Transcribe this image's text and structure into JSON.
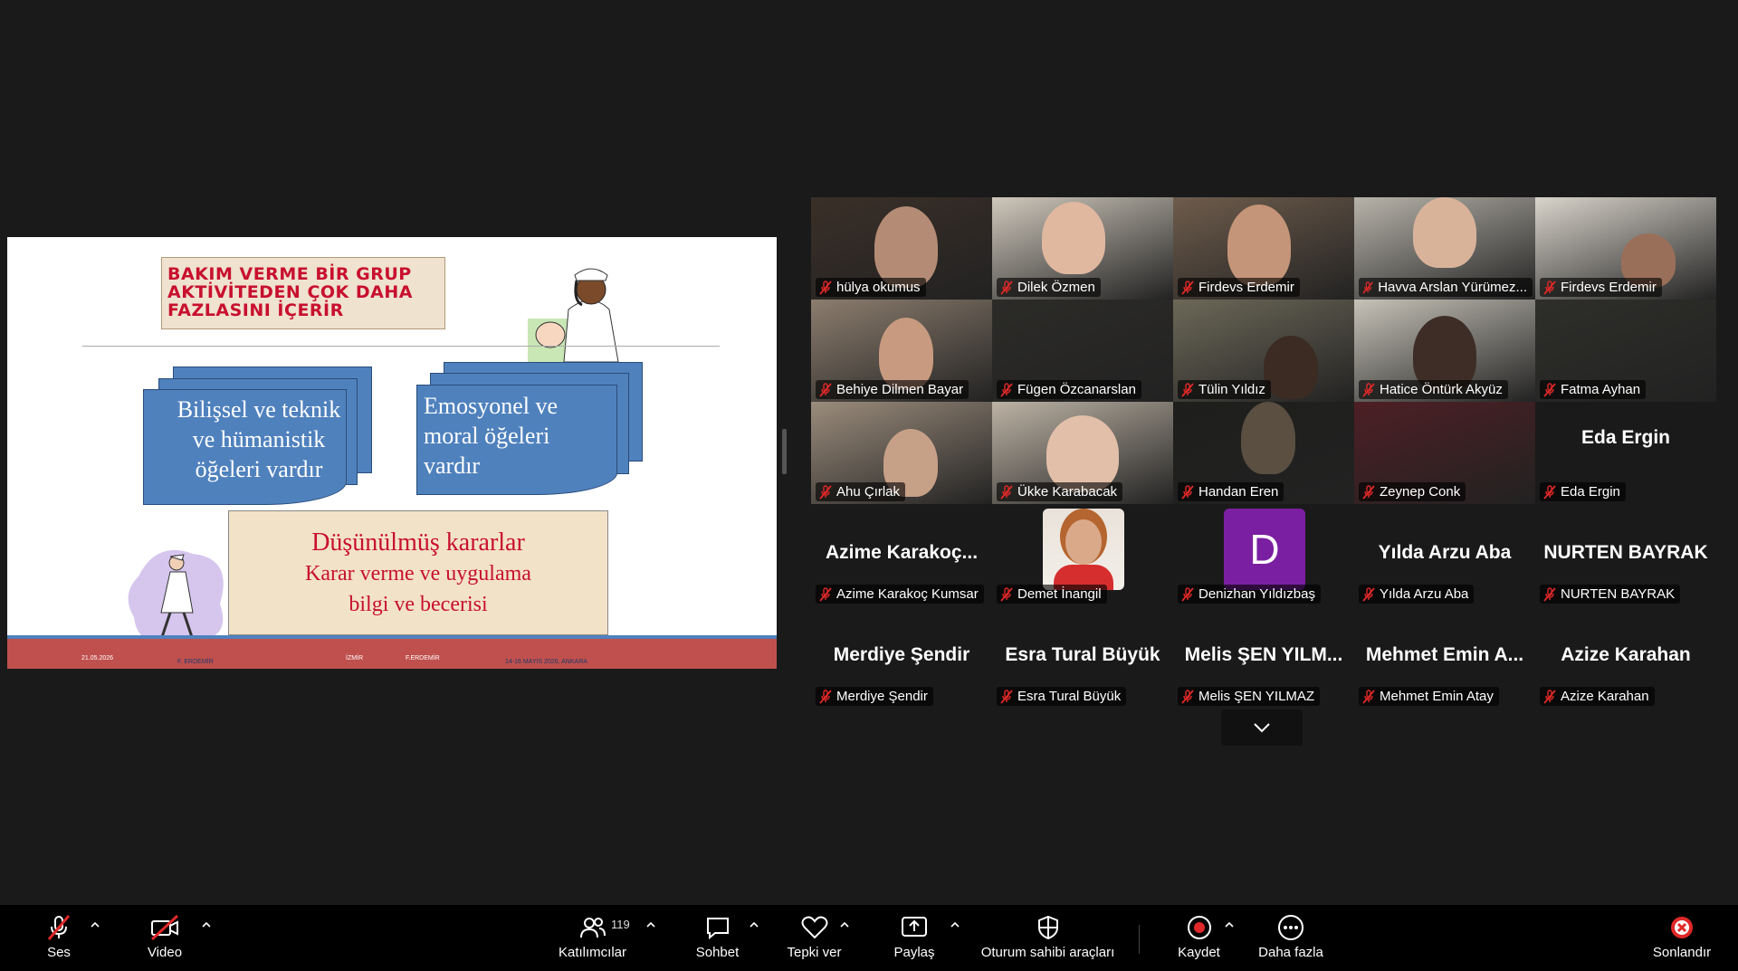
{
  "slide": {
    "title": "BAKIM VERME BİR GRUP AKTİVİTEDEN ÇOK DAHA FAZLASINI İÇERİR",
    "box_left": "Bilişsel ve teknik ve hümanistik öğeleri vardır",
    "box_right": "Emosyonel ve moral öğeleri vardır",
    "decision_line1": "Düşünülmüş kararlar",
    "decision_line2": "Karar verme ve uygulama",
    "decision_line3": "bilgi ve becerisi",
    "footer": {
      "date": "21.05.2026",
      "author1": "F. ERDEMİR",
      "city": "İZMİR",
      "author2": "F.ERDEMİR",
      "event": "14-16 MAYIS 2026, ANKARA"
    }
  },
  "participants": [
    {
      "name": "hülya okumus",
      "big": ""
    },
    {
      "name": "Dilek Özmen",
      "big": ""
    },
    {
      "name": "Firdevs Erdemir",
      "big": ""
    },
    {
      "name": "Havva Arslan Yürümez...",
      "big": ""
    },
    {
      "name": "Firdevs Erdemir",
      "big": ""
    },
    {
      "name": "Behiye Dilmen Bayar",
      "big": ""
    },
    {
      "name": "Fügen Özcanarslan",
      "big": ""
    },
    {
      "name": "Tülin Yıldız",
      "big": ""
    },
    {
      "name": "Hatice Öntürk Akyüz",
      "big": ""
    },
    {
      "name": "Fatma Ayhan",
      "big": ""
    },
    {
      "name": "Ahu Çırlak",
      "big": ""
    },
    {
      "name": "Ükke Karabacak",
      "big": ""
    },
    {
      "name": "Handan Eren",
      "big": ""
    },
    {
      "name": "Zeynep Conk",
      "big": ""
    },
    {
      "name": "Eda Ergin",
      "big": "Eda Ergin"
    },
    {
      "name": "Azime Karakoç Kumsar",
      "big": "Azime  Karakoç..."
    },
    {
      "name": "Demet İnangil",
      "big": ""
    },
    {
      "name": "Denizhan Yıldızbaş",
      "big": "D"
    },
    {
      "name": "Yılda Arzu Aba",
      "big": "Yılda Arzu Aba"
    },
    {
      "name": "NURTEN BAYRAK",
      "big": "NURTEN BAYRAK"
    },
    {
      "name": "Merdiye Şendir",
      "big": "Merdiye Şendir"
    },
    {
      "name": "Esra Tural Büyük",
      "big": "Esra Tural Büyük"
    },
    {
      "name": "Melis ŞEN YILMAZ",
      "big": "Melis  ŞEN  YILM..."
    },
    {
      "name": "Mehmet Emin Atay",
      "big": "Mehmet  Emin  A..."
    },
    {
      "name": "Azize Karahan",
      "big": "Azize Karahan"
    }
  ],
  "toolbar": {
    "audio": "Ses",
    "video": "Video",
    "participants": "Katılımcılar",
    "participants_count": "119",
    "chat": "Sohbet",
    "react": "Tepki ver",
    "share": "Paylaş",
    "host_tools": "Oturum sahibi araçları",
    "record": "Kaydet",
    "more": "Daha fazla",
    "end": "Sonlandır"
  },
  "icons": {
    "mic_muted": "mic-muted-icon",
    "video_off": "video-off-icon",
    "participants": "people-icon",
    "chat": "chat-bubble-icon",
    "react": "heart-icon",
    "share": "share-screen-icon",
    "host": "shield-icon",
    "record": "record-icon",
    "more": "more-dots-icon",
    "end": "close-circle-icon",
    "scroll": "chevron-down-icon"
  },
  "colors": {
    "active_speaker": "#2ecc71",
    "muted": "#e02828",
    "record": "#e02828",
    "end": "#e02828",
    "avatar_d": "#7b1fa2"
  }
}
